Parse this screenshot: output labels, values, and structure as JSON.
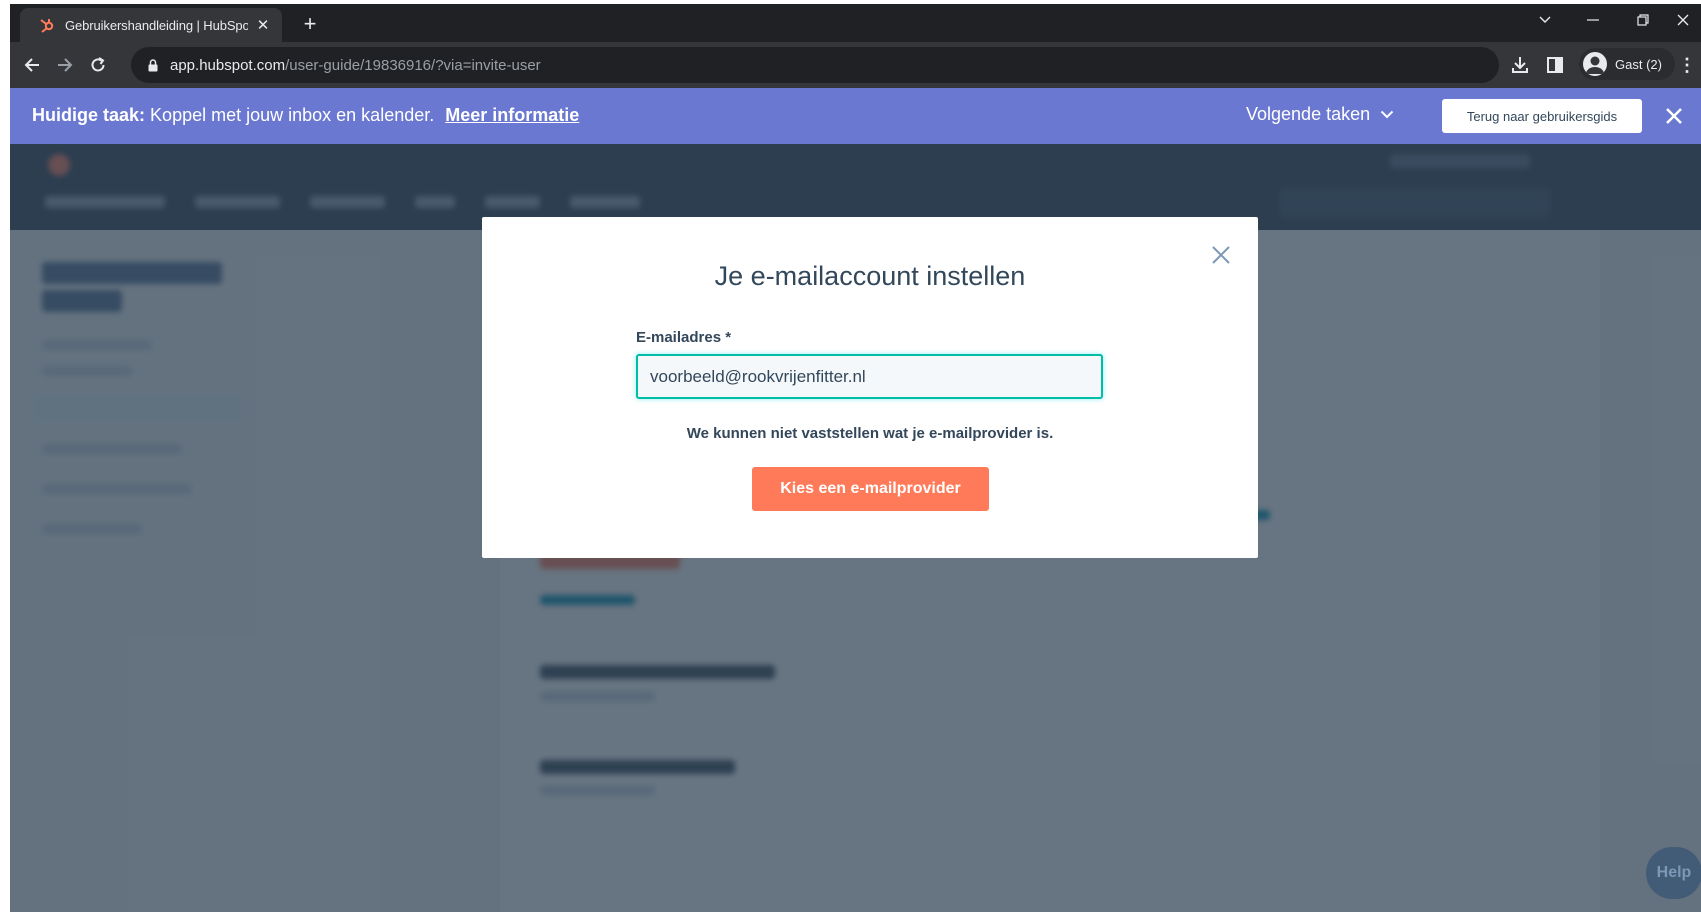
{
  "browser": {
    "tab": {
      "title": "Gebruikershandleiding | HubSpo"
    },
    "url": {
      "host": "app.hubspot.com",
      "path": "/user-guide/19836916/?via=invite-user"
    },
    "profile_label": "Gast (2)"
  },
  "task_banner": {
    "label": "Huidige taak:",
    "text": "Koppel met jouw inbox en kalender.",
    "link": "Meer informatie",
    "next_tasks": "Volgende taken",
    "back_button": "Terug naar gebruikersgids"
  },
  "background_app": {
    "help_label": "Help"
  },
  "modal": {
    "title": "Je e-mailaccount instellen",
    "field_label": "E-mailadres *",
    "email_value": "voorbeeld@rookvrijenfitter.nl",
    "message": "We kunnen niet vaststellen wat je e-mailprovider is.",
    "button_label": "Kies een e-mailprovider"
  },
  "colors": {
    "banner": "#6a78d1",
    "accent_button": "#ff7a59",
    "input_focus": "#00bda5",
    "hubspot_nav": "#2d3e50"
  }
}
